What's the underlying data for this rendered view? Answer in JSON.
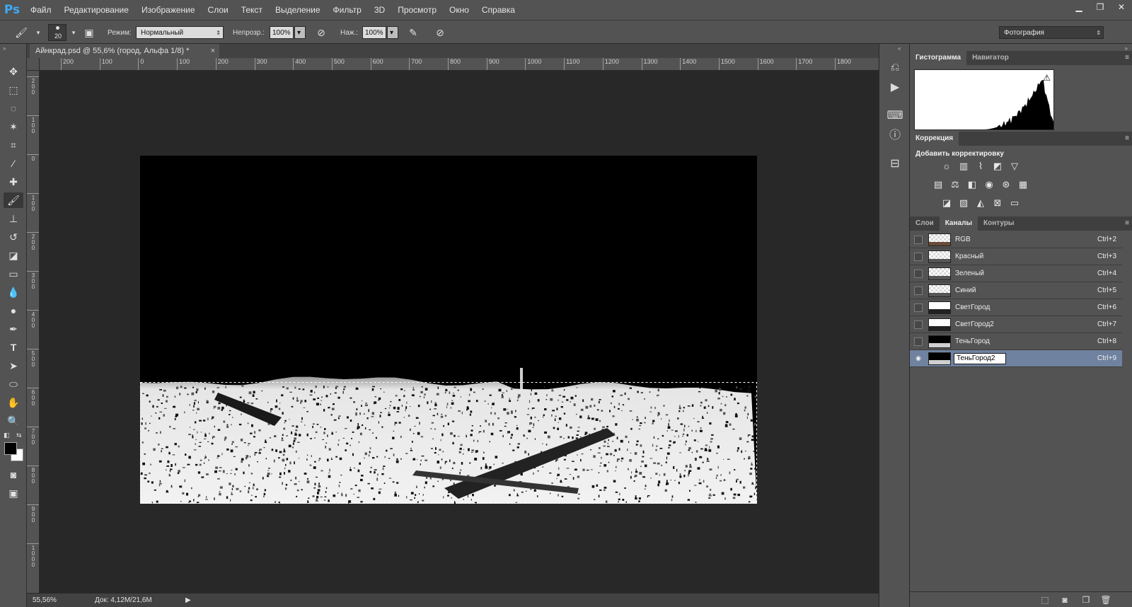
{
  "app": {
    "logo": "Ps"
  },
  "menu": [
    "Файл",
    "Редактирование",
    "Изображение",
    "Слои",
    "Текст",
    "Выделение",
    "Фильтр",
    "3D",
    "Просмотр",
    "Окно",
    "Справка"
  ],
  "window_controls": {
    "minimize": "▁",
    "restore": "❐",
    "close": "✕"
  },
  "options": {
    "brush_size": "20",
    "mode_label": "Режим:",
    "mode_value": "Нормальный",
    "opacity_label": "Непрозр.:",
    "opacity_value": "100%",
    "pressure_label": "Наж.:",
    "pressure_value": "100%",
    "workspace_value": "Фотография"
  },
  "document": {
    "tab_title": "Айнкрад.psd @ 55,6% (город, Альфа 1/8) *",
    "close": "×"
  },
  "ruler_h": [
    "200",
    "100",
    "0",
    "100",
    "200",
    "300",
    "400",
    "500",
    "600",
    "700",
    "800",
    "900",
    "1000",
    "1100",
    "1200",
    "1300",
    "1400",
    "1500",
    "1600",
    "1700",
    "1800"
  ],
  "ruler_v": [
    "2\n0\n0",
    "1\n0\n0",
    "0",
    "1\n0\n0",
    "2\n0\n0",
    "3\n0\n0",
    "4\n0\n0",
    "5\n0\n0",
    "6\n0\n0",
    "7\n0\n0",
    "8\n0\n0",
    "9\n0\n0",
    "1\n0\n0\n0"
  ],
  "status": {
    "zoom": "55,56%",
    "doc_info": "Док: 4,12M/21,6M",
    "arrow": "▶"
  },
  "panels": {
    "top_tabs": [
      "Гистограмма",
      "Навигатор"
    ],
    "histogram_warning": "⚠",
    "correction_tab": "Коррекция",
    "correction_title": "Добавить корректировку",
    "bottom_tabs": [
      "Слои",
      "Каналы",
      "Контуры"
    ],
    "panel_menu": "≡"
  },
  "channels": [
    {
      "name": "RGB",
      "shortcut": "Ctrl+2",
      "visible": false,
      "selected": false,
      "editing": false
    },
    {
      "name": "Красный",
      "shortcut": "Ctrl+3",
      "visible": false,
      "selected": false,
      "editing": false
    },
    {
      "name": "Зеленый",
      "shortcut": "Ctrl+4",
      "visible": false,
      "selected": false,
      "editing": false
    },
    {
      "name": "Синий",
      "shortcut": "Ctrl+5",
      "visible": false,
      "selected": false,
      "editing": false
    },
    {
      "name": "СветГород",
      "shortcut": "Ctrl+6",
      "visible": false,
      "selected": false,
      "editing": false
    },
    {
      "name": "СветГород2",
      "shortcut": "Ctrl+7",
      "visible": false,
      "selected": false,
      "editing": false
    },
    {
      "name": "ТеньГород",
      "shortcut": "Ctrl+8",
      "visible": false,
      "selected": false,
      "editing": false
    },
    {
      "name": "ТеньГород2",
      "shortcut": "Ctrl+9",
      "visible": true,
      "selected": true,
      "editing": true
    }
  ],
  "colors": {
    "accent": "#3fa9f5",
    "selection_row": "#6f829f",
    "chrome": "#535353",
    "workspace": "#282828"
  }
}
